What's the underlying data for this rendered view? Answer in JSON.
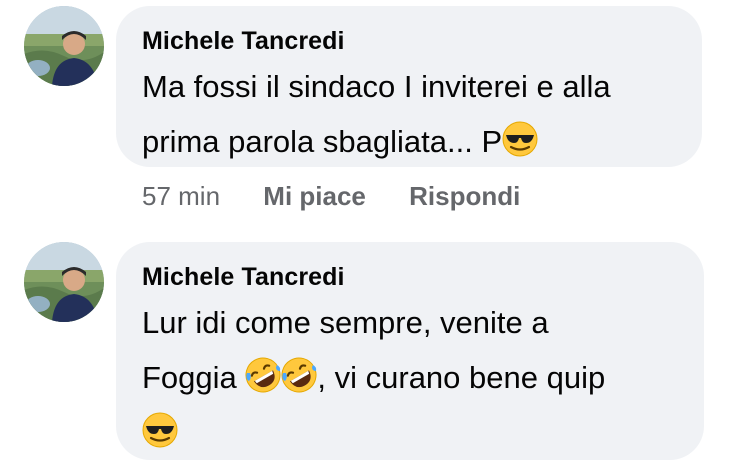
{
  "comments": [
    {
      "author": "Michele Tancredi",
      "line1": "Ma fossi il sindaco I inviterei e alla",
      "line2": "prima parola sbagliata... P",
      "time": "57 min",
      "like": "Mi piace",
      "reply": "Rispondi"
    },
    {
      "author": "Michele Tancredi",
      "line1": "Lur idi come sempre, venite a",
      "line2_start": "Foggia ",
      "line2_end": ", vi curano bene quip"
    }
  ],
  "icons": {
    "avatar": "profile-photo",
    "sunglasses": "smiling-face-with-sunglasses-emoji",
    "laughing": "rolling-on-floor-laughing-emoji"
  },
  "colors": {
    "bubble": "#f0f2f5",
    "meta": "#65676b",
    "text": "#050505",
    "emoji_yellow": "#ffc83d"
  }
}
